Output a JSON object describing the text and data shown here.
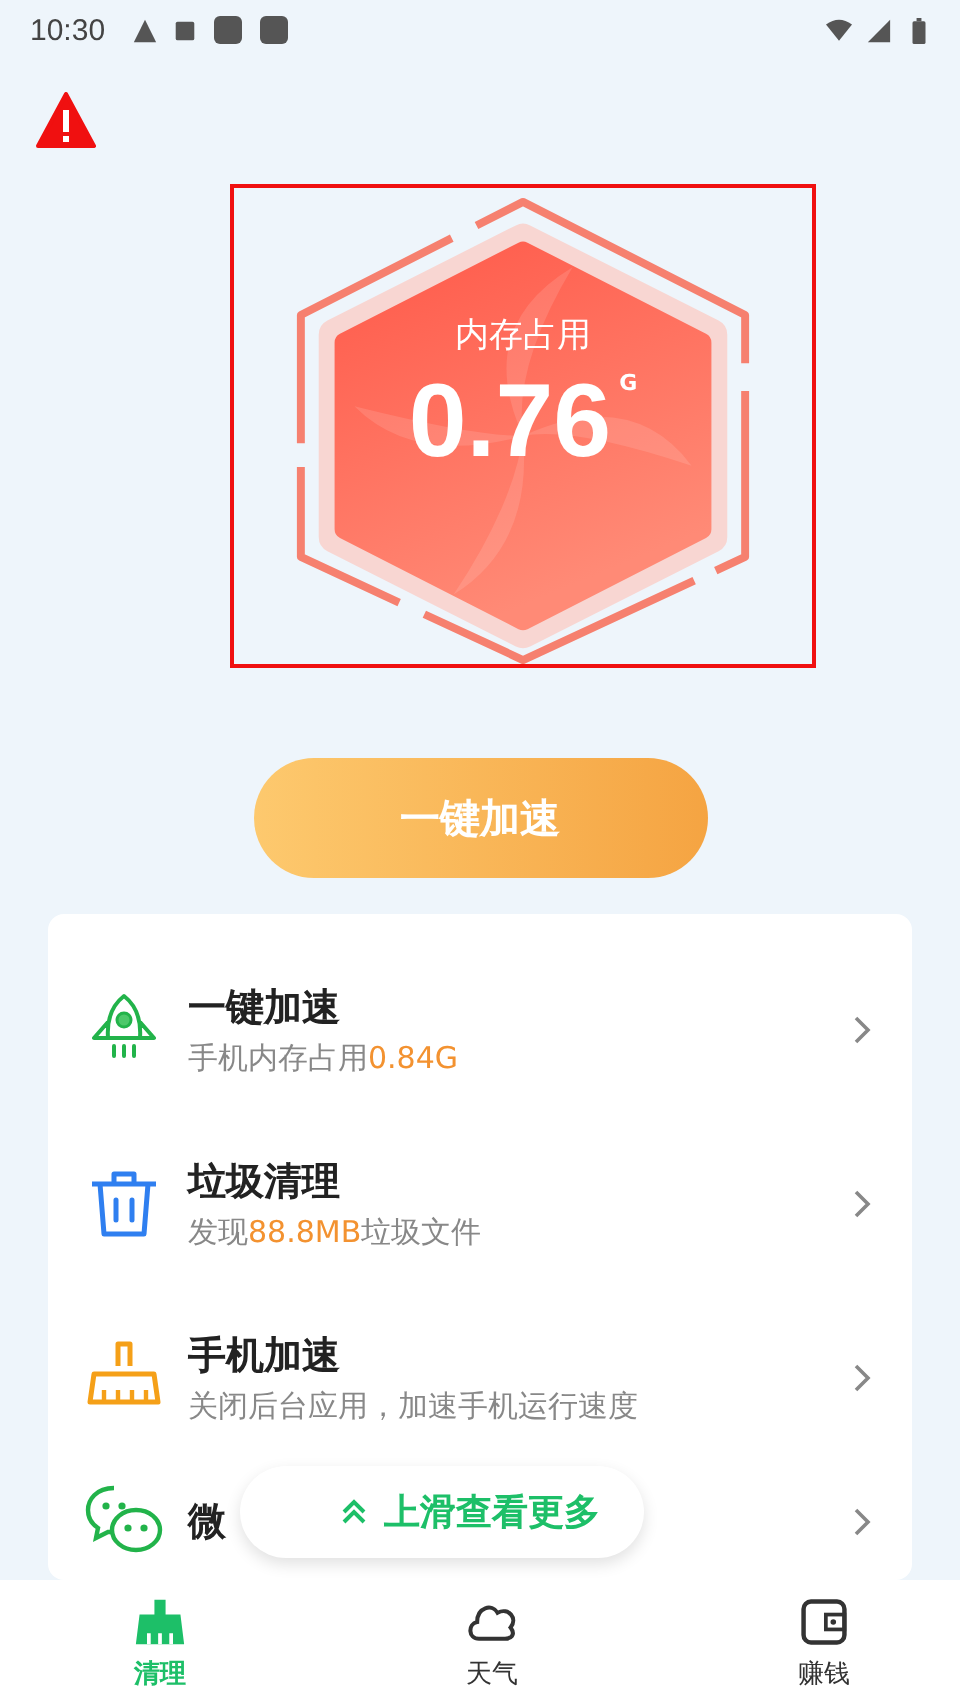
{
  "status_bar": {
    "time": "10:30"
  },
  "gauge": {
    "label": "内存占用",
    "value": "0.76",
    "unit": "G"
  },
  "boost_button": {
    "label": "一键加速"
  },
  "features": [
    {
      "kind": "rocket",
      "title": "一键加速",
      "subtitle": [
        {
          "text": "手机内存占用",
          "highlight": false
        },
        {
          "text": "0.84G",
          "highlight": true
        }
      ]
    },
    {
      "kind": "trash",
      "title": "垃圾清理",
      "subtitle": [
        {
          "text": "发现",
          "highlight": false
        },
        {
          "text": "88.8MB",
          "highlight": true
        },
        {
          "text": "垃圾文件",
          "highlight": false
        }
      ]
    },
    {
      "kind": "broom",
      "title": "手机加速",
      "subtitle": [
        {
          "text": "关闭后台应用，加速手机运行速度",
          "highlight": false
        }
      ]
    },
    {
      "kind": "chat",
      "title": "微"
    }
  ],
  "scroll_hint": {
    "label": "上滑查看更多"
  },
  "tabs": [
    {
      "kind": "broom",
      "label": "清理",
      "selected": true
    },
    {
      "kind": "cloud",
      "label": "天气",
      "selected": false
    },
    {
      "kind": "wallet",
      "label": "赚钱",
      "selected": false
    }
  ]
}
